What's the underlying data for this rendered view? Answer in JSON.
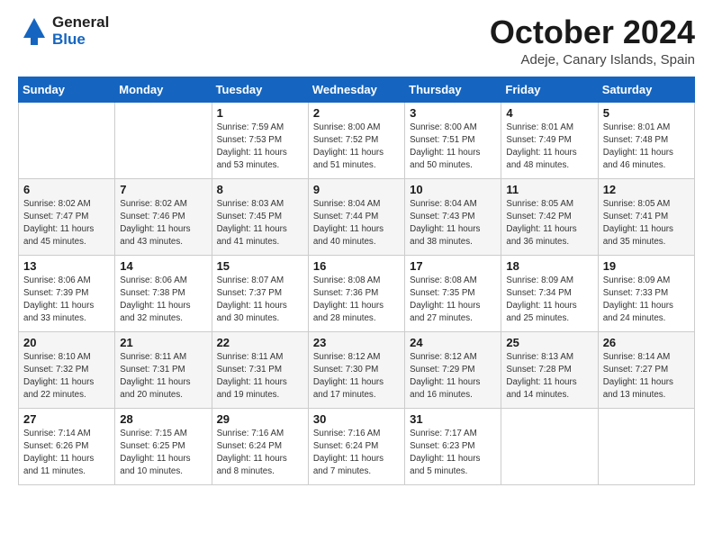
{
  "header": {
    "logo_general": "General",
    "logo_blue": "Blue",
    "title": "October 2024",
    "location": "Adeje, Canary Islands, Spain"
  },
  "weekdays": [
    "Sunday",
    "Monday",
    "Tuesday",
    "Wednesday",
    "Thursday",
    "Friday",
    "Saturday"
  ],
  "weeks": [
    [
      {
        "day": "",
        "info": ""
      },
      {
        "day": "",
        "info": ""
      },
      {
        "day": "1",
        "info": "Sunrise: 7:59 AM\nSunset: 7:53 PM\nDaylight: 11 hours and 53 minutes."
      },
      {
        "day": "2",
        "info": "Sunrise: 8:00 AM\nSunset: 7:52 PM\nDaylight: 11 hours and 51 minutes."
      },
      {
        "day": "3",
        "info": "Sunrise: 8:00 AM\nSunset: 7:51 PM\nDaylight: 11 hours and 50 minutes."
      },
      {
        "day": "4",
        "info": "Sunrise: 8:01 AM\nSunset: 7:49 PM\nDaylight: 11 hours and 48 minutes."
      },
      {
        "day": "5",
        "info": "Sunrise: 8:01 AM\nSunset: 7:48 PM\nDaylight: 11 hours and 46 minutes."
      }
    ],
    [
      {
        "day": "6",
        "info": "Sunrise: 8:02 AM\nSunset: 7:47 PM\nDaylight: 11 hours and 45 minutes."
      },
      {
        "day": "7",
        "info": "Sunrise: 8:02 AM\nSunset: 7:46 PM\nDaylight: 11 hours and 43 minutes."
      },
      {
        "day": "8",
        "info": "Sunrise: 8:03 AM\nSunset: 7:45 PM\nDaylight: 11 hours and 41 minutes."
      },
      {
        "day": "9",
        "info": "Sunrise: 8:04 AM\nSunset: 7:44 PM\nDaylight: 11 hours and 40 minutes."
      },
      {
        "day": "10",
        "info": "Sunrise: 8:04 AM\nSunset: 7:43 PM\nDaylight: 11 hours and 38 minutes."
      },
      {
        "day": "11",
        "info": "Sunrise: 8:05 AM\nSunset: 7:42 PM\nDaylight: 11 hours and 36 minutes."
      },
      {
        "day": "12",
        "info": "Sunrise: 8:05 AM\nSunset: 7:41 PM\nDaylight: 11 hours and 35 minutes."
      }
    ],
    [
      {
        "day": "13",
        "info": "Sunrise: 8:06 AM\nSunset: 7:39 PM\nDaylight: 11 hours and 33 minutes."
      },
      {
        "day": "14",
        "info": "Sunrise: 8:06 AM\nSunset: 7:38 PM\nDaylight: 11 hours and 32 minutes."
      },
      {
        "day": "15",
        "info": "Sunrise: 8:07 AM\nSunset: 7:37 PM\nDaylight: 11 hours and 30 minutes."
      },
      {
        "day": "16",
        "info": "Sunrise: 8:08 AM\nSunset: 7:36 PM\nDaylight: 11 hours and 28 minutes."
      },
      {
        "day": "17",
        "info": "Sunrise: 8:08 AM\nSunset: 7:35 PM\nDaylight: 11 hours and 27 minutes."
      },
      {
        "day": "18",
        "info": "Sunrise: 8:09 AM\nSunset: 7:34 PM\nDaylight: 11 hours and 25 minutes."
      },
      {
        "day": "19",
        "info": "Sunrise: 8:09 AM\nSunset: 7:33 PM\nDaylight: 11 hours and 24 minutes."
      }
    ],
    [
      {
        "day": "20",
        "info": "Sunrise: 8:10 AM\nSunset: 7:32 PM\nDaylight: 11 hours and 22 minutes."
      },
      {
        "day": "21",
        "info": "Sunrise: 8:11 AM\nSunset: 7:31 PM\nDaylight: 11 hours and 20 minutes."
      },
      {
        "day": "22",
        "info": "Sunrise: 8:11 AM\nSunset: 7:31 PM\nDaylight: 11 hours and 19 minutes."
      },
      {
        "day": "23",
        "info": "Sunrise: 8:12 AM\nSunset: 7:30 PM\nDaylight: 11 hours and 17 minutes."
      },
      {
        "day": "24",
        "info": "Sunrise: 8:12 AM\nSunset: 7:29 PM\nDaylight: 11 hours and 16 minutes."
      },
      {
        "day": "25",
        "info": "Sunrise: 8:13 AM\nSunset: 7:28 PM\nDaylight: 11 hours and 14 minutes."
      },
      {
        "day": "26",
        "info": "Sunrise: 8:14 AM\nSunset: 7:27 PM\nDaylight: 11 hours and 13 minutes."
      }
    ],
    [
      {
        "day": "27",
        "info": "Sunrise: 7:14 AM\nSunset: 6:26 PM\nDaylight: 11 hours and 11 minutes."
      },
      {
        "day": "28",
        "info": "Sunrise: 7:15 AM\nSunset: 6:25 PM\nDaylight: 11 hours and 10 minutes."
      },
      {
        "day": "29",
        "info": "Sunrise: 7:16 AM\nSunset: 6:24 PM\nDaylight: 11 hours and 8 minutes."
      },
      {
        "day": "30",
        "info": "Sunrise: 7:16 AM\nSunset: 6:24 PM\nDaylight: 11 hours and 7 minutes."
      },
      {
        "day": "31",
        "info": "Sunrise: 7:17 AM\nSunset: 6:23 PM\nDaylight: 11 hours and 5 minutes."
      },
      {
        "day": "",
        "info": ""
      },
      {
        "day": "",
        "info": ""
      }
    ]
  ]
}
